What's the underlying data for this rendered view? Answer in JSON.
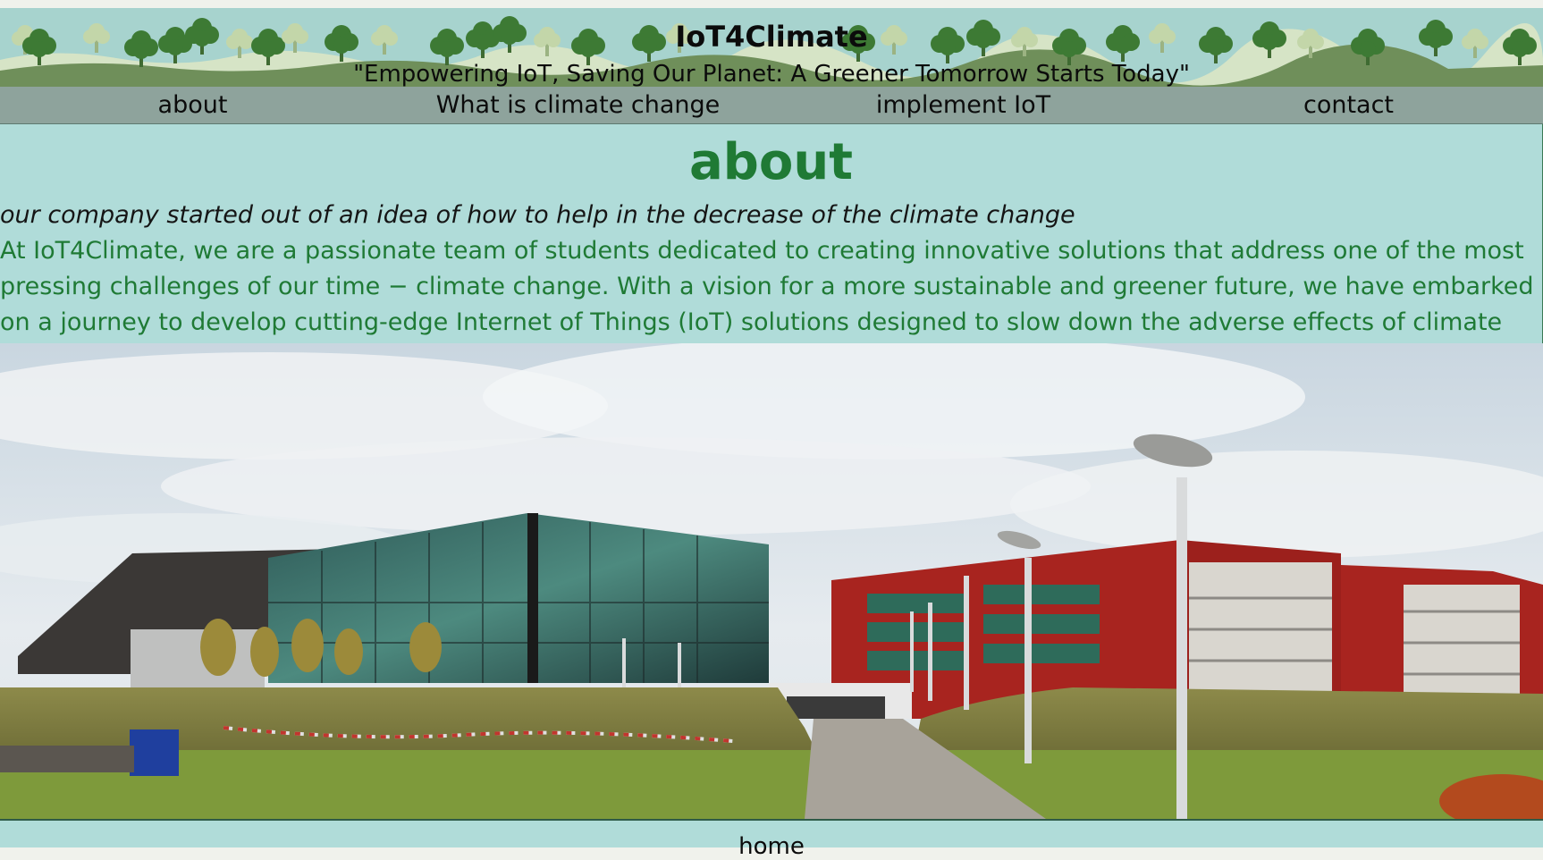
{
  "header": {
    "title": "IoT4Climate",
    "tagline": "\"Empowering IoT, Saving Our Planet: A Greener Tomorrow Starts Today\""
  },
  "nav": {
    "items": [
      {
        "label": "about"
      },
      {
        "label": "What is climate change"
      },
      {
        "label": "implement IoT"
      },
      {
        "label": "contact"
      }
    ]
  },
  "main": {
    "heading": "about",
    "intro": "our company started out of an idea of how to help in the decrease of the climate change",
    "description": "At IoT4Climate, we are a passionate team of students dedicated to creating innovative solutions that address one of the most pressing challenges of our time − climate change. With a vision for a more sustainable and greener future, we have embarked on a journey to develop cutting-edge Internet of Things (IoT) solutions designed to slow down the adverse effects of climate change."
  },
  "footer": {
    "link": "home"
  },
  "colors": {
    "header_bg": "#a7d3ce",
    "nav_bg": "#8ea39c",
    "content_bg": "#b0dcd9",
    "accent_green": "#1f7a35",
    "building_red": "#a8241f"
  }
}
